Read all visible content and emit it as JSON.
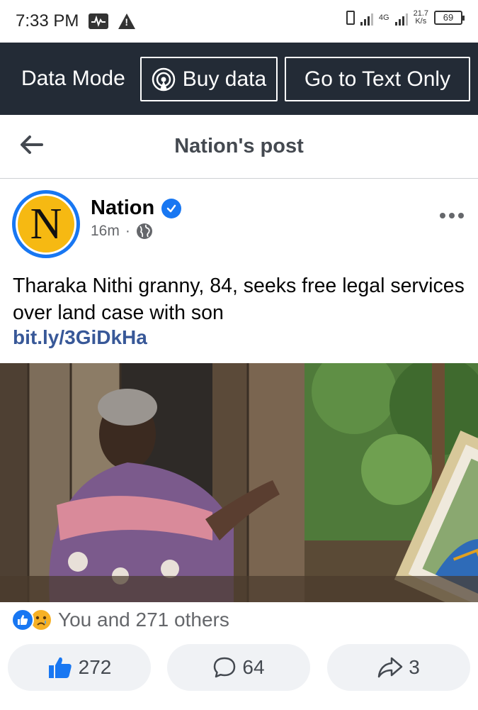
{
  "status_bar": {
    "time": "7:33 PM",
    "network": "4G",
    "speed": "21.7",
    "speed_unit": "K/s",
    "battery": "69"
  },
  "data_bar": {
    "mode_label": "Data Mode",
    "buy_data_label": "Buy data",
    "text_only_label": "Go to Text Only",
    "background": "#232b36"
  },
  "header": {
    "title": "Nation's post",
    "back_icon": "arrow-left-icon"
  },
  "post": {
    "page_name": "Nation",
    "avatar_letter": "N",
    "verified_icon": "verified-badge-icon",
    "time_ago": "16m",
    "separator": "·",
    "privacy_icon": "globe-icon",
    "text": "Tharaka Nithi granny, 84, seeks free legal services over land case with son",
    "link": "bit.ly/3GiDkHa",
    "more_icon": "more-dots-icon"
  },
  "reactions": {
    "summary": "You and 271 others",
    "icons": [
      "like-icon",
      "sad-icon"
    ]
  },
  "actions": {
    "like_count": "272",
    "comment_count": "64",
    "share_count": "3"
  },
  "colors": {
    "facebook_blue": "#1877f2",
    "link_blue": "#385898",
    "nation_yellow": "#f6b912"
  }
}
